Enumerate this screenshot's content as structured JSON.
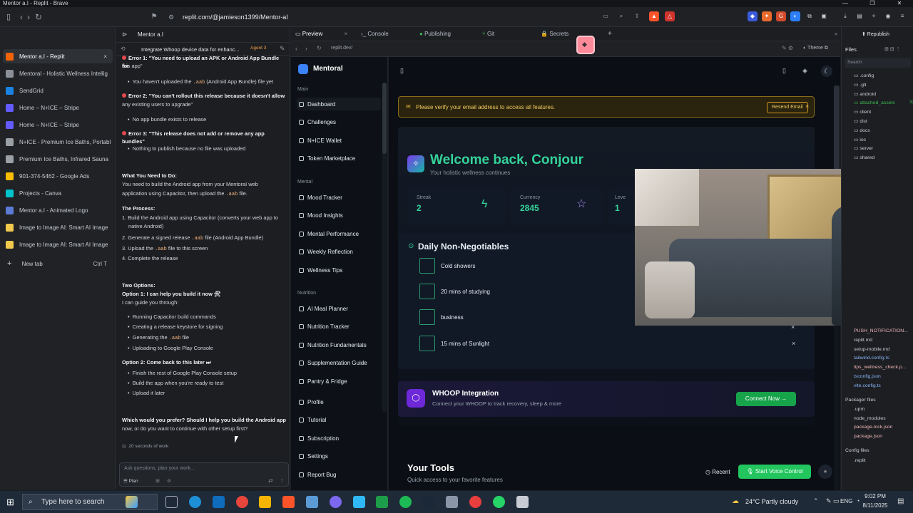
{
  "window_title": "Mentor a.I - Replit - Brave",
  "address_url": "replit.com/@jamieson1399/Mentor-aI",
  "tabs": [
    {
      "label": "Mentor a.I - Replit",
      "active": true,
      "color": "#f26207"
    },
    {
      "label": "Mentoral - Holistic Wellness Intellig",
      "color": "#8a8f98"
    },
    {
      "label": "SendGrid",
      "color": "#1a82e2"
    },
    {
      "label": "Home – N+ICE – Stripe",
      "color": "#635bff"
    },
    {
      "label": "Home – N+ICE – Stripe",
      "color": "#635bff"
    },
    {
      "label": "N+ICE - Premium Ice Baths, Portabl",
      "color": "#9aa0a6"
    },
    {
      "label": "Premium Ice Baths, Infrared Sauna",
      "color": "#9aa0a6"
    },
    {
      "label": "901-374-5462 - Google Ads",
      "color": "#fbbc04"
    },
    {
      "label": "Projects - Canva",
      "color": "#00c4cc"
    },
    {
      "label": "Mentor a.I - Animated Logo",
      "color": "#5b7bd5"
    },
    {
      "label": "Image to Image AI: Smart AI Image",
      "color": "#f2c94c"
    },
    {
      "label": "Image to Image AI: Smart AI Image",
      "color": "#f2c94c"
    }
  ],
  "new_tab": {
    "label": "New tab",
    "shortcut": "Ctrl T"
  },
  "workspace_tabs": {
    "preview": "Preview",
    "console": "Console",
    "publishing": "Publishing",
    "git": "Git",
    "secrets": "Secrets"
  },
  "project_name": "Mentor a.I",
  "chat": {
    "title": "Integrate Whoop device data for enhanc...",
    "agent_badge": "Agent 3",
    "lines": {
      "e1a": "Error 1: \"You need to upload an APK or Android App Bundle for",
      "e1b": "this app\"",
      "b1": "You haven't uploaded the",
      "b1code": ".aab",
      "b1rest": "(Android App Bundle) file yet",
      "e2": "Error 2: \"You can't rollout this release because it doesn't allow",
      "e2b": "any existing users to upgrade\"",
      "b2": "No app bundle exists to release",
      "e3": "Error 3: \"This release does not add or remove any app bundles\"",
      "b3": "Nothing to publish because no file was uploaded",
      "h1": "What You Need to Do:",
      "p1a": "You need to build the Android app from your MentoraI web",
      "p1b": "application using Capacitor, then upload the",
      "p1code": ".aab",
      "p1c": "file.",
      "h2": "The Process:",
      "s1a": "1. Build the Android app using Capacitor (converts your web app to",
      "s1b": "native Android)",
      "s2": "2. Generate a signed release",
      "s2code": ".aab",
      "s2b": "file (Android App Bundle)",
      "s3": "3. Upload the",
      "s3code": ".aab",
      "s3b": "file to this screen",
      "s4": "4. Complete the release",
      "h3": "Two Options:",
      "o1": "Option 1: I can help you build it now 🛠",
      "o1b": "I can guide you through:",
      "g1": "Running Capacitor build commands",
      "g2": "Creating a release keystore for signing",
      "g3": "Generating the",
      "g3code": ".aab",
      "g3b": "file",
      "g4": "Uploading to Google Play Console",
      "o2": "Option 2: Come back to this later ⏭",
      "g5": "Finish the rest of Google Play Console setup",
      "g6": "Build the app when you're ready to test",
      "g7": "Upload it later",
      "q1": "Which would you prefer? Should I help you build the Android app",
      "q2": "now, or do you want to continue with other setup first?",
      "work": "20 seconds of work"
    },
    "input_placeholder": "Ask questions, plan your work...",
    "plan_label": "Plan"
  },
  "preview_url": "replit.dev/",
  "app": {
    "brand": "Mentoral",
    "sections": {
      "main": "Main",
      "mental": "Mental",
      "nutrition": "Nutrition"
    },
    "nav_main": [
      "Dashboard",
      "Challenges",
      "N+ICE Wallet",
      "Token Marketplace"
    ],
    "nav_mental": [
      "Mood Tracker",
      "Mood Insights",
      "Mental Performance",
      "Weekly Reflection",
      "Wellness Tips"
    ],
    "nav_nutrition": [
      "AI Meal Planner",
      "Nutrition Tracker",
      "Nutrition Fundamentals",
      "Supplementation Guide",
      "Pantry & Fridge"
    ],
    "nav_bottom": [
      "Profile",
      "Tutorial",
      "Subscription",
      "Settings",
      "Report Bug"
    ],
    "banner_text": "Please verify your email address to access all features.",
    "resend": "Resend Email",
    "welcome": "Welcome back, Conjour",
    "welcome_sub": "Your holistic wellness continues",
    "stats": [
      {
        "label": "Streak",
        "value": "2"
      },
      {
        "label": "Currency",
        "value": "2845"
      },
      {
        "label": "Leve",
        "value": "1"
      }
    ],
    "dnn_title": "Daily Non-Negotiables",
    "dnn_items": [
      "Cold showers",
      "20 mins of studying",
      "business",
      "15 mins of Sunlight"
    ],
    "whoop_title": "WHOOP Integration",
    "whoop_sub": "Connect your WHOOP to track recovery, sleep & more",
    "connect": "Connect Now",
    "tools_title": "Your Tools",
    "tools_sub": "Quick access to your favorite features",
    "recent": "Recent",
    "voice": "Start Voice Control"
  },
  "files": {
    "title": "Files",
    "search": "Search",
    "items": [
      ".config",
      ".git",
      "android",
      "attached_assets",
      "client",
      "dist",
      "docs",
      "ios",
      "server",
      "shared"
    ],
    "badge": "32",
    "lower": [
      "PUSH_NOTIFICATION...",
      "replit.md",
      "setup-mobile.md",
      "tailwind.config.ts",
      "tips_wellness_check.p...",
      "tsconfig.json",
      "vite.config.ts"
    ],
    "packager_title": "Packager files",
    "packager": [
      ".upm",
      "node_modules",
      "package-lock.json",
      "package.json"
    ],
    "config_title": "Config files",
    "config": [
      ".replit"
    ]
  },
  "taskbar": {
    "search": "Type here to search",
    "weather": "24°C  Partly cloudy",
    "lang": "ENG",
    "time": "9:02 PM",
    "date": "8/11/2025"
  }
}
